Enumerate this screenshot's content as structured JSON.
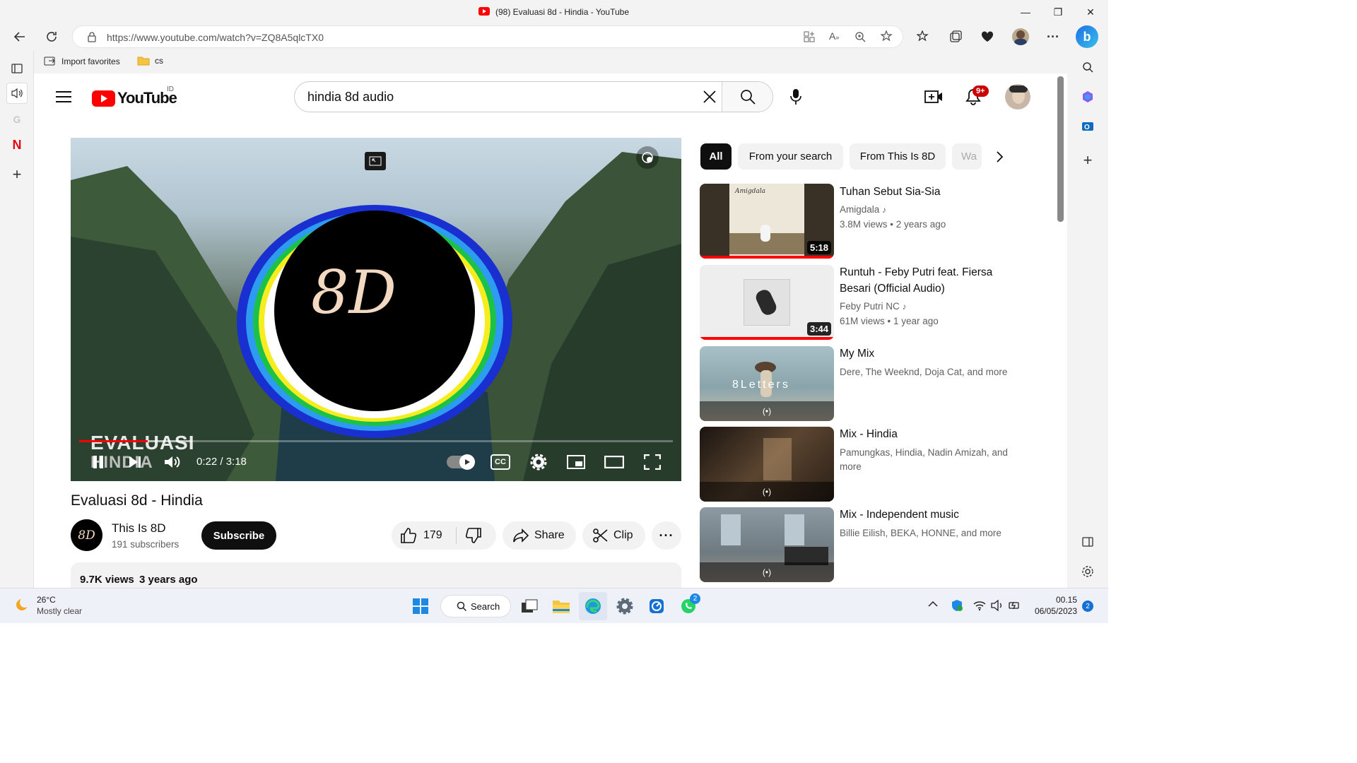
{
  "browser": {
    "window_title": "(98) Evaluasi 8d - Hindia - YouTube",
    "url": "https://www.youtube.com/watch?v=ZQ8A5qlcTX0",
    "favorites": [
      {
        "label": "Import favorites"
      },
      {
        "label": "cs"
      }
    ],
    "bing_label": "b"
  },
  "youtube": {
    "logo_text": "YouTube",
    "country_code": "ID",
    "search_value": "hindia 8d audio",
    "notifications_badge": "9+"
  },
  "player": {
    "overlay_text_1": "EVALUASI",
    "overlay_text_2": "HINDIA",
    "time": "0:22 / 3:18",
    "progress": 0.115,
    "logo_text": "8D",
    "cc_label": "CC"
  },
  "video": {
    "title": "Evaluasi 8d - Hindia",
    "channel_name": "This Is 8D",
    "channel_avatar_text": "8D",
    "subscribers": "191 subscribers",
    "subscribe_label": "Subscribe",
    "likes": "179",
    "share_label": "Share",
    "clip_label": "Clip",
    "views": "9.7K views",
    "age": "3 years ago"
  },
  "chips": [
    "All",
    "From your search",
    "From This Is 8D",
    "Wa"
  ],
  "suggestions": [
    {
      "title": "Tuhan Sebut Sia-Sia",
      "channel": "Amigdala",
      "stats": "3.8M views",
      "age": "2 years ago",
      "duration": "5:18",
      "thumb_text": "Amigdala"
    },
    {
      "title": "Runtuh - Feby Putri feat. Fiersa Besari (Official Audio)",
      "channel": "Feby Putri NC",
      "stats": "61M views",
      "age": "1 year ago",
      "duration": "3:44"
    },
    {
      "title": "My Mix",
      "meta": "Dere, The Weeknd, Doja Cat, and more",
      "thumb_text": "8Letters"
    },
    {
      "title": "Mix - Hindia",
      "meta": "Pamungkas, Hindia, Nadin Amizah, and more"
    },
    {
      "title": "Mix - Independent music",
      "meta": "Billie Eilish, BEKA, HONNE, and more"
    }
  ],
  "mix_icon": "(•)",
  "taskbar": {
    "weather_temp": "26°C",
    "weather_desc": "Mostly clear",
    "search_label": "Search",
    "whatsapp_badge": "2",
    "time": "00.15",
    "date": "06/05/2023",
    "notification_count": "2"
  },
  "colors": {
    "youtube_red": "#ff0000",
    "subscribe_bg": "#0f0f0f",
    "chip_active": "#0f0f0f"
  }
}
